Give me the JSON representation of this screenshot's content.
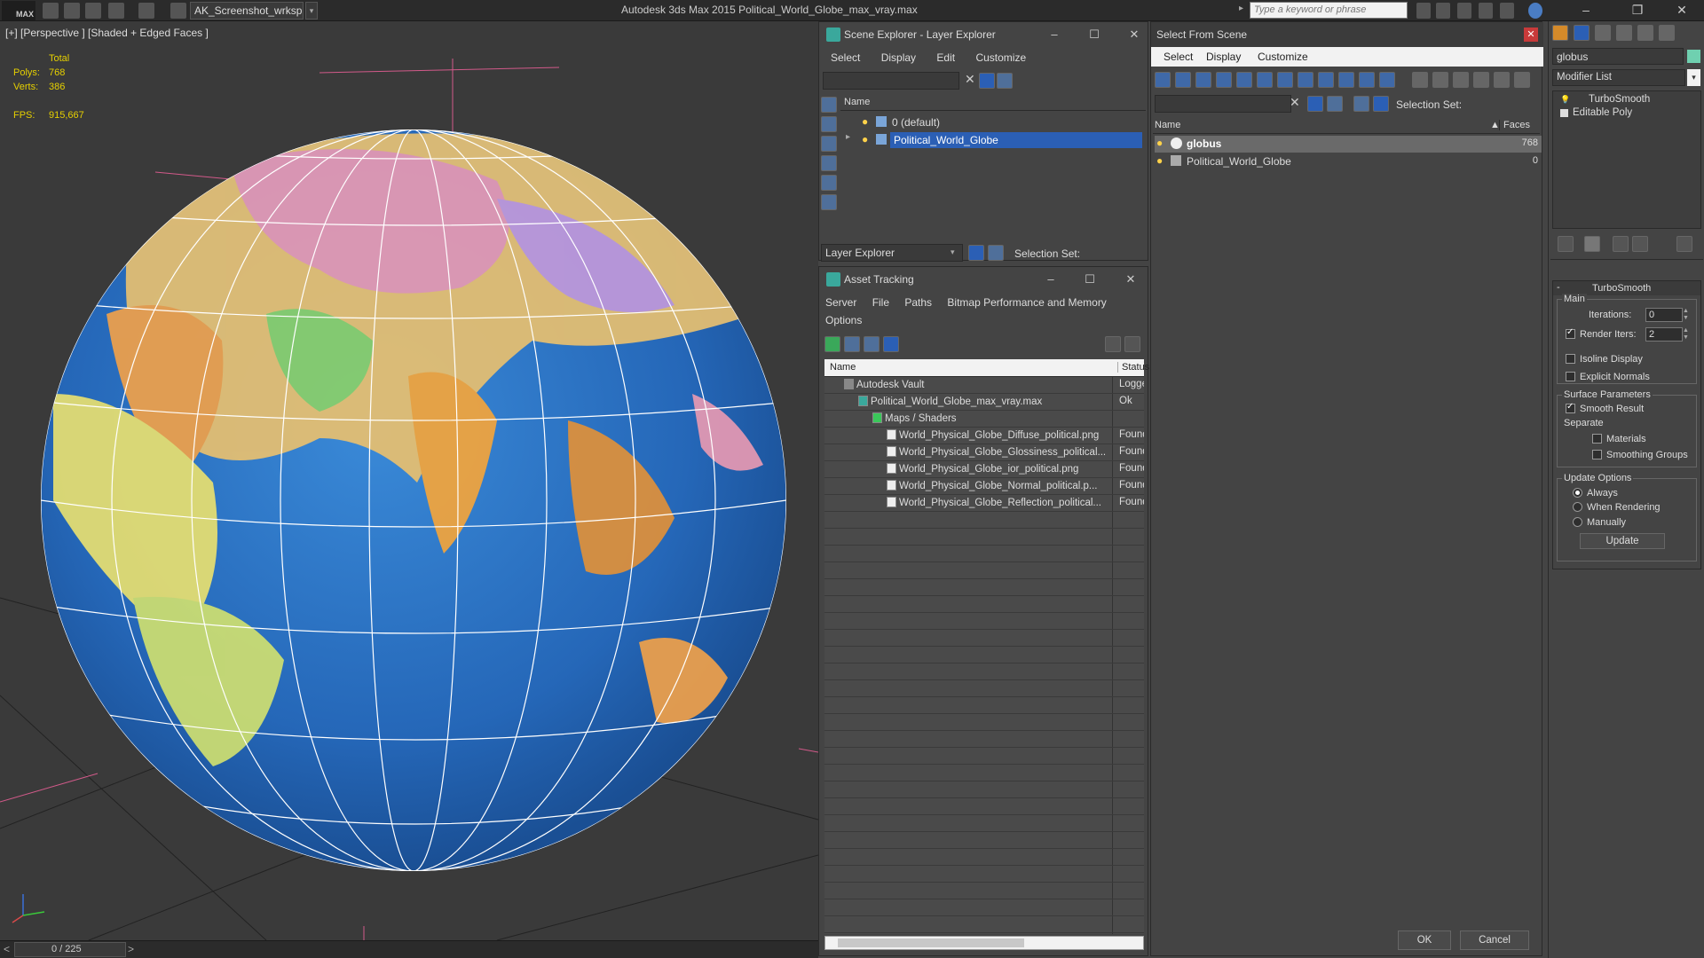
{
  "titlebar": {
    "logo": "MAX",
    "workspace": "AK_Screenshot_wrksp",
    "title": "Autodesk 3ds Max  2015      Political_World_Globe_max_vray.max",
    "search_placeholder": "Type a keyword or phrase"
  },
  "viewport": {
    "label": "[+] [Perspective ] [Shaded + Edged Faces ]",
    "stats": {
      "total_label": "Total",
      "polys_label": "Polys:",
      "polys_value": "768",
      "verts_label": "Verts:",
      "verts_value": "386",
      "fps_label": "FPS:",
      "fps_value": "915,667"
    }
  },
  "statusbar": {
    "prev": "<",
    "frame": "0 / 225",
    "next": ">"
  },
  "scene_explorer": {
    "title": "Scene Explorer - Layer Explorer",
    "menu": [
      "Select",
      "Display",
      "Edit",
      "Customize"
    ],
    "column_name": "Name",
    "layers": [
      "0 (default)",
      "Political_World_Globe"
    ],
    "footer_select": "Layer Explorer",
    "footer_selection_set": "Selection Set:"
  },
  "asset_tracking": {
    "title": "Asset Tracking",
    "menu": [
      "Server",
      "File",
      "Paths",
      "Bitmap Performance and Memory"
    ],
    "menu_row2": [
      "Options"
    ],
    "col_name": "Name",
    "col_status": "Status",
    "rows": [
      {
        "name": "Autodesk Vault",
        "status": "Logged",
        "indent": 0
      },
      {
        "name": "Political_World_Globe_max_vray.max",
        "status": "Ok",
        "indent": 1
      },
      {
        "name": "Maps / Shaders",
        "status": "",
        "indent": 2
      },
      {
        "name": "World_Physical_Globe_Diffuse_political.png",
        "status": "Found",
        "indent": 3
      },
      {
        "name": "World_Physical_Globe_Glossiness_political...",
        "status": "Found",
        "indent": 3
      },
      {
        "name": "World_Physical_Globe_ior_political.png",
        "status": "Found",
        "indent": 3
      },
      {
        "name": "World_Physical_Globe_Normal_political.p...",
        "status": "Found",
        "indent": 3
      },
      {
        "name": "World_Physical_Globe_Reflection_political...",
        "status": "Found",
        "indent": 3
      }
    ]
  },
  "select_from_scene": {
    "title": "Select From Scene",
    "menu": [
      "Select",
      "Display",
      "Customize"
    ],
    "selection_set": "Selection Set:",
    "col_name": "Name",
    "col_faces": "Faces",
    "rows": [
      {
        "name": "globus",
        "faces": "768"
      },
      {
        "name": "Political_World_Globe",
        "faces": "0"
      }
    ],
    "ok": "OK",
    "cancel": "Cancel"
  },
  "command_panel": {
    "object_name": "globus",
    "modifier_list": "Modifier List",
    "stack": [
      "TurboSmooth",
      "Editable Poly"
    ],
    "rollout_title": "TurboSmooth",
    "main_label": "Main",
    "iterations_label": "Iterations:",
    "iterations_value": "0",
    "render_iters_label": "Render Iters:",
    "render_iters_value": "2",
    "isoline_label": "Isoline Display",
    "explicit_normals_label": "Explicit Normals",
    "surface_params_label": "Surface Parameters",
    "smooth_result_label": "Smooth Result",
    "separate_label": "Separate",
    "materials_label": "Materials",
    "smoothing_groups_label": "Smoothing Groups",
    "update_options_label": "Update Options",
    "always_label": "Always",
    "when_rendering_label": "When Rendering",
    "manually_label": "Manually",
    "update_button": "Update"
  },
  "colors": {
    "accent_selection": "#2b5fb5",
    "stats_yellow": "#e6d000",
    "ocean": "#2a72c0"
  }
}
